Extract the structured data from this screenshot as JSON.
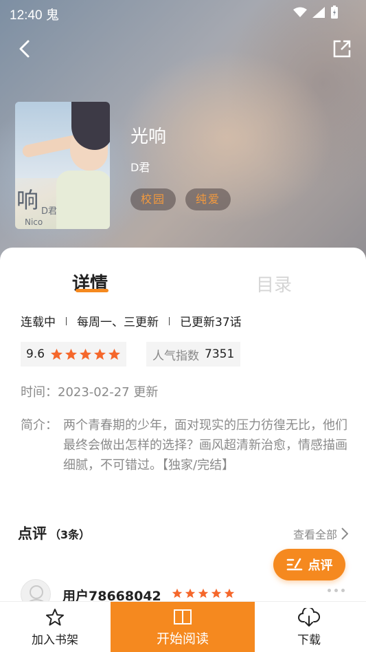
{
  "status_bar": {
    "time": "12:40",
    "carrier_glyph": "鬼"
  },
  "book": {
    "title": "光响",
    "author": "D君",
    "tags": [
      "校园",
      "纯爱"
    ],
    "cover": {
      "title_glyph": "响",
      "author_text": "D君",
      "nico_text": "Nico"
    }
  },
  "tabs": {
    "detail": "详情",
    "catalog": "目录"
  },
  "meta": {
    "status": "连载中",
    "schedule": "每周一、三更新",
    "updated": "已更新37话"
  },
  "score": {
    "value": "9.6",
    "stars": 5
  },
  "popularity": {
    "label": "人气指数",
    "value": "7351"
  },
  "time": {
    "text": "时间：2023-02-27 更新"
  },
  "intro": {
    "label": "简介：",
    "text": "两个青春期的少年，面对现实的压力彷徨无比，他们最终会做出怎样的选择？画风超清新治愈，情感描画细腻，不可错过。【独家/完结】"
  },
  "reviews": {
    "title": "点评",
    "count": "（3条）",
    "view_all": "查看全部",
    "comment_button": "点评"
  },
  "comment": {
    "user": "用户78668042",
    "stars": 5
  },
  "bottom_bar": {
    "shelf": "加入书架",
    "read": "开始阅读",
    "download": "下载"
  },
  "colors": {
    "accent": "#f5891f",
    "star": "#f5672b"
  },
  "icons": [
    "back-icon",
    "share-icon",
    "wifi-icon",
    "signal-icon",
    "battery-icon",
    "star-icon",
    "chevron-right-icon",
    "comment-edit-icon",
    "more-icon",
    "bookshelf-star-icon",
    "book-open-icon",
    "download-cloud-icon"
  ]
}
